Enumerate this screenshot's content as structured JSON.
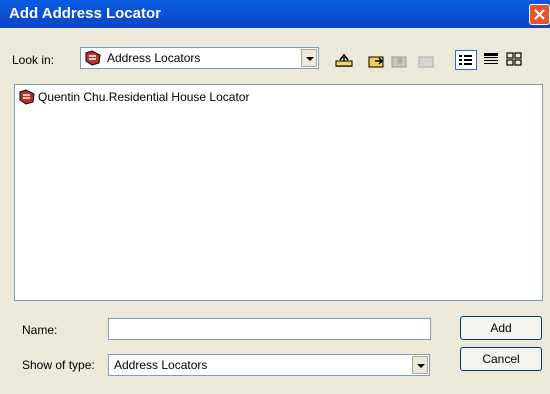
{
  "window": {
    "title": "Add Address Locator"
  },
  "lookin": {
    "label": "Look in:",
    "value": "Address Locators"
  },
  "toolbar": {
    "icons": [
      "up-one-level-icon",
      "connect-folder-icon",
      "disconnect-folder-icon",
      "new-folder-icon",
      "list-view-icon",
      "details-view-icon",
      "thumbnails-view-icon"
    ]
  },
  "file_list": {
    "items": [
      {
        "label": "Quentin Chu.Residential House Locator",
        "icon": "address-locator-icon"
      }
    ]
  },
  "name_field": {
    "label": "Name:",
    "value": ""
  },
  "type_field": {
    "label": "Show of type:",
    "value": "Address Locators"
  },
  "buttons": {
    "add": "Add",
    "cancel": "Cancel"
  },
  "colors": {
    "title_bar": "#0a52d8",
    "close_button": "#e2552f",
    "dialog_bg": "#ece9d8",
    "field_border": "#7f9db9"
  }
}
